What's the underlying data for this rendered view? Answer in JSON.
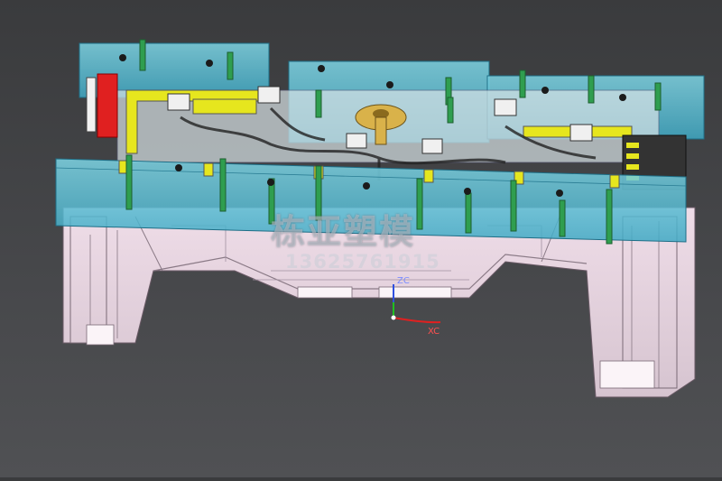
{
  "viewport": {
    "background_color": "#46474a"
  },
  "watermark": {
    "title": "栋亚塑模",
    "phone": "13625761915"
  },
  "triad": {
    "zc_label": "ZC",
    "xc_label": "XC",
    "x_color": "#e02020",
    "z_color": "#3050e0",
    "y_color": "#20c020"
  },
  "model_colors": {
    "plate": "#5fc3d8",
    "mold_base": "#e8d8e4",
    "cylinder_track": "#e0e020",
    "heater": "#e02020",
    "bolts": "#30a050",
    "rotor": "#d9b24a"
  }
}
